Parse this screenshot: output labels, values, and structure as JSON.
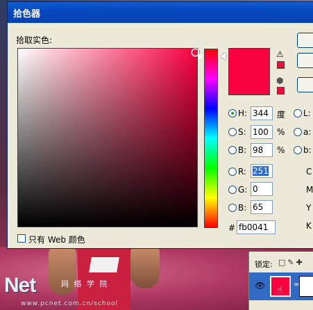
{
  "dialog": {
    "title": "拾色器",
    "subtitle": "拾取实色:",
    "field_color": "#fb0041"
  },
  "fields": {
    "h": {
      "label": "H:",
      "value": "344",
      "unit": "度",
      "checked": true
    },
    "s": {
      "label": "S:",
      "value": "100",
      "unit": "%"
    },
    "b": {
      "label": "B:",
      "value": "98",
      "unit": "%"
    },
    "r": {
      "label": "R:",
      "value": "251"
    },
    "g": {
      "label": "G:",
      "value": "0"
    },
    "b2": {
      "label": "B:",
      "value": "65"
    },
    "hex_label": "#",
    "hex_value": "fb0041"
  },
  "right_labels": {
    "l": "L:",
    "a": "a:",
    "b": "b:",
    "c": "C",
    "m": "M",
    "y": "Y",
    "k": "K"
  },
  "web_only": {
    "label": "只有 Web 颜色",
    "checked": false
  },
  "layers": {
    "lock_label": "锁定:"
  },
  "watermark": {
    "brand": "Net",
    "cn": "网 络 学 院",
    "url": "www.pcnet.com.cn/school"
  },
  "colors": {
    "accent": "#fb0041",
    "titlebar": "#0848c0"
  }
}
